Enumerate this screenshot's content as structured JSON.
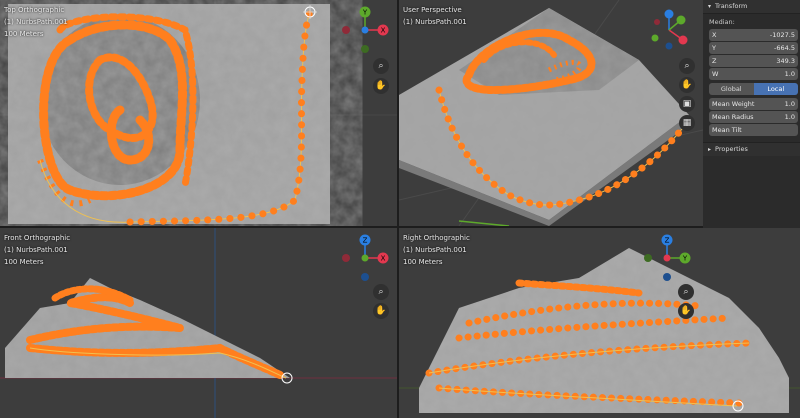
{
  "viewports": {
    "top": {
      "title": "Top Orthographic",
      "object": "(1) NurbsPath.001",
      "scale": "100 Meters"
    },
    "user": {
      "title": "User Perspective",
      "object": "(1) NurbsPath.001"
    },
    "front": {
      "title": "Front Orthographic",
      "object": "(1) NurbsPath.001",
      "scale": "100 Meters"
    },
    "right": {
      "title": "Right Orthographic",
      "object": "(1) NurbsPath.001",
      "scale": "100 Meters"
    }
  },
  "gizmo": {
    "x": "X",
    "y": "Y",
    "z": "Z"
  },
  "colors": {
    "x": "#e3384f",
    "y": "#5da92b",
    "z": "#2a7fe2",
    "curve": "#ff7f1e",
    "panel_active": "#4772b3"
  },
  "nav_icons": [
    "zoom-icon",
    "hand-icon",
    "camera-icon",
    "grid-icon"
  ],
  "sidebar": {
    "transform_title": "Transform",
    "median_label": "Median:",
    "fields": [
      {
        "label": "X",
        "value": "-1027.5"
      },
      {
        "label": "Y",
        "value": "-664.5"
      },
      {
        "label": "Z",
        "value": "349.3"
      },
      {
        "label": "W",
        "value": "1.0"
      }
    ],
    "toggle": {
      "global": "Global",
      "local": "Local"
    },
    "weights": [
      {
        "label": "Mean Weight",
        "value": "1.0"
      },
      {
        "label": "Mean Radius",
        "value": "1.0"
      },
      {
        "label": "Mean Tilt",
        "value": ""
      }
    ],
    "properties_title": "Properties"
  }
}
